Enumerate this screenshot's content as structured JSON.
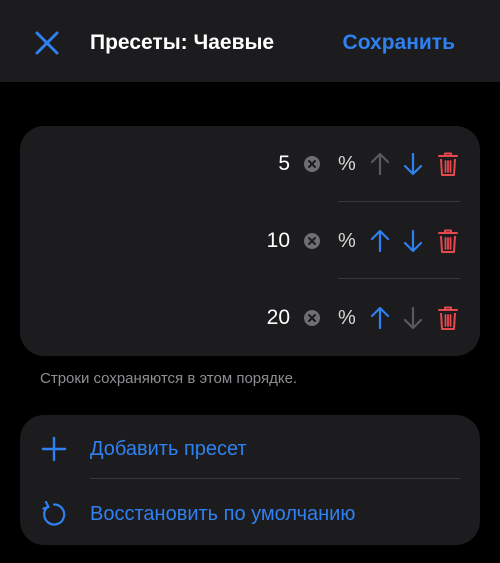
{
  "header": {
    "title": "Пресеты: Чаевые",
    "save_label": "Сохранить",
    "close_icon": "close-icon"
  },
  "presets": [
    {
      "value": "5",
      "unit": "%",
      "move_up_enabled": false,
      "move_down_enabled": true
    },
    {
      "value": "10",
      "unit": "%",
      "move_up_enabled": true,
      "move_down_enabled": true
    },
    {
      "value": "20",
      "unit": "%",
      "move_up_enabled": true,
      "move_down_enabled": false
    }
  ],
  "hint": "Строки сохраняются в этом порядке.",
  "actions": {
    "add_label": "Добавить пресет",
    "restore_label": "Восстановить по умолчанию"
  },
  "colors": {
    "background": "#000000",
    "card": "#1c1c1e",
    "accent": "#2f80f0",
    "destructive": "#e5484d",
    "disabled": "#5a5a5e",
    "secondary_text": "#8e8e93"
  }
}
